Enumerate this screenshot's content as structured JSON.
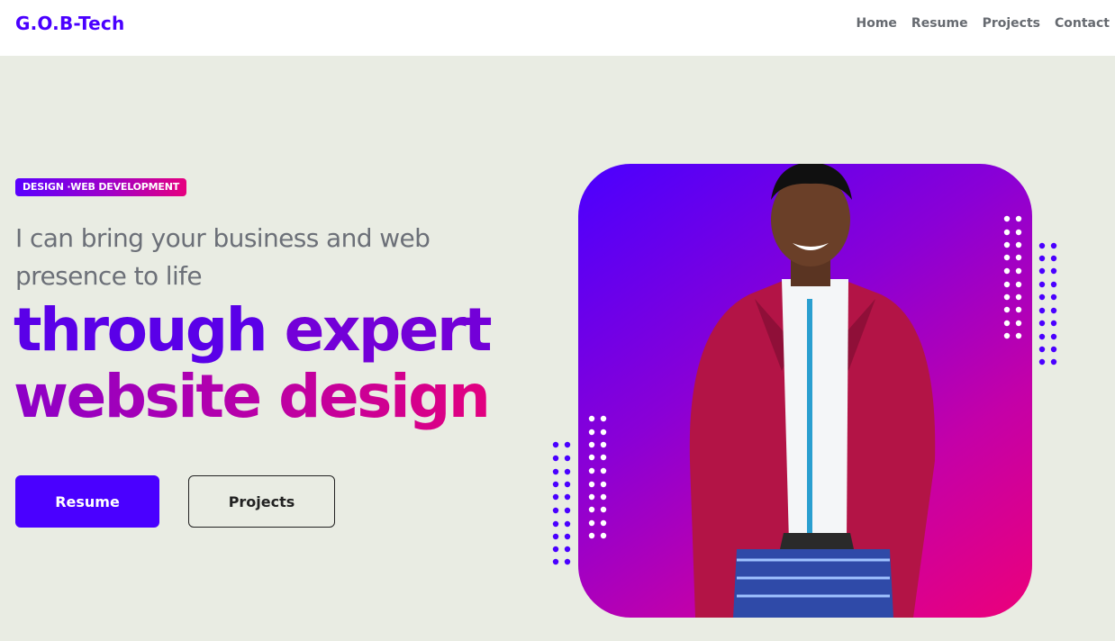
{
  "nav": {
    "logo": "G.O.B-Tech",
    "links": [
      "Home",
      "Resume",
      "Projects",
      "Contact"
    ]
  },
  "hero": {
    "badge": "DESIGN ·WEB DEVELOPMENT",
    "tagline": "I can bring your business and web presence to life",
    "headline_line1_a": "through",
    "headline_line1_b": "expert",
    "headline_line2": "website design",
    "buttons": {
      "resume": "Resume",
      "projects": "Projects"
    }
  },
  "colors": {
    "accent": "#4a00ff",
    "gradient_start": "#4a00ff",
    "gradient_end": "#ec007a",
    "background": "#e9ece3"
  },
  "icons": [
    "dot-pattern-decoration"
  ]
}
